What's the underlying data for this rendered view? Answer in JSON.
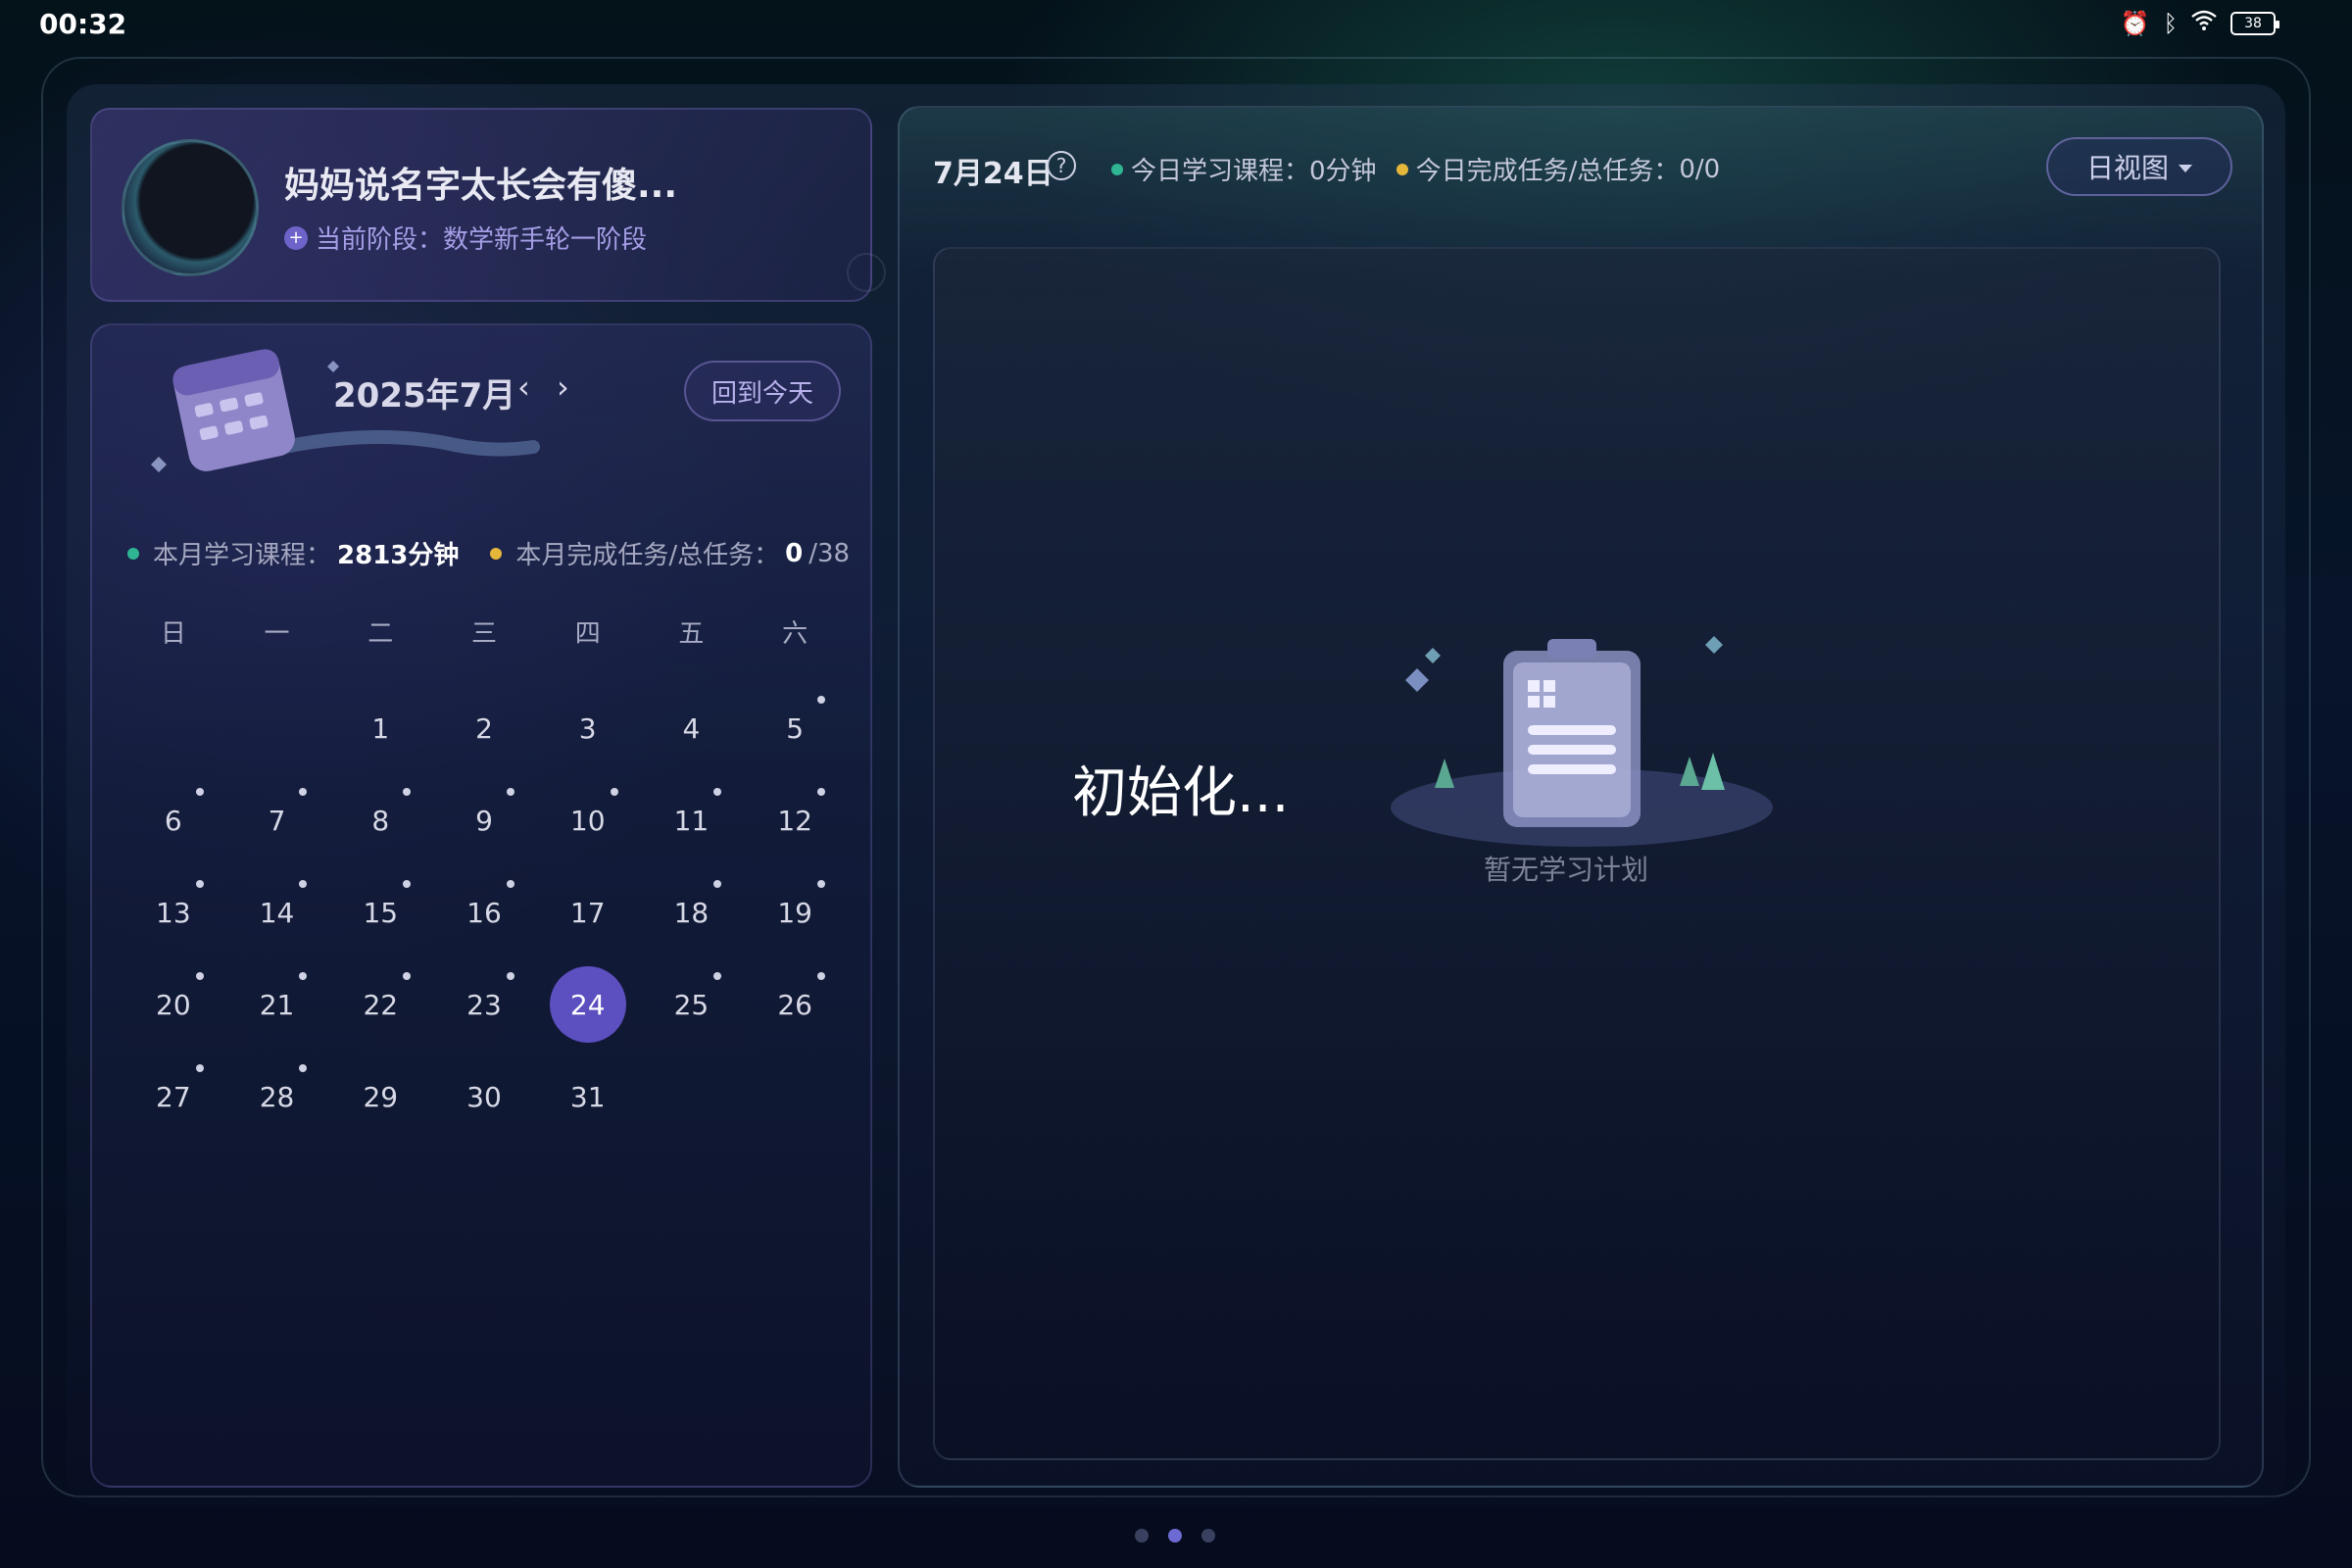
{
  "status_bar": {
    "time": "00:32",
    "battery": "38",
    "icons": [
      "alarm-icon",
      "bluetooth-icon",
      "wifi-icon",
      "battery-icon"
    ]
  },
  "profile": {
    "name": "妈妈说名字太长会有傻...",
    "stage": "当前阶段：数学新手轮一阶段"
  },
  "calendar": {
    "month_title": "2025年7月",
    "prev": "‹",
    "next": "›",
    "today_button": "回到今天",
    "stats": {
      "course_label": "本月学习课程：",
      "course_value": "2813分钟",
      "task_label": "本月完成任务/总任务：",
      "task_done": "0",
      "task_total": "/38"
    },
    "weekdays": [
      "日",
      "一",
      "二",
      "三",
      "四",
      "五",
      "六"
    ],
    "leading_blanks": 2,
    "days": [
      {
        "d": "1",
        "mark": false
      },
      {
        "d": "2",
        "mark": false
      },
      {
        "d": "3",
        "mark": false
      },
      {
        "d": "4",
        "mark": false
      },
      {
        "d": "5",
        "mark": true
      },
      {
        "d": "6",
        "mark": true
      },
      {
        "d": "7",
        "mark": true
      },
      {
        "d": "8",
        "mark": true
      },
      {
        "d": "9",
        "mark": true
      },
      {
        "d": "10",
        "mark": true
      },
      {
        "d": "11",
        "mark": true
      },
      {
        "d": "12",
        "mark": true
      },
      {
        "d": "13",
        "mark": true
      },
      {
        "d": "14",
        "mark": true
      },
      {
        "d": "15",
        "mark": true
      },
      {
        "d": "16",
        "mark": true
      },
      {
        "d": "17",
        "mark": false
      },
      {
        "d": "18",
        "mark": true
      },
      {
        "d": "19",
        "mark": true
      },
      {
        "d": "20",
        "mark": true
      },
      {
        "d": "21",
        "mark": true
      },
      {
        "d": "22",
        "mark": true
      },
      {
        "d": "23",
        "mark": true
      },
      {
        "d": "24",
        "mark": false,
        "selected": true
      },
      {
        "d": "25",
        "mark": true
      },
      {
        "d": "26",
        "mark": true
      },
      {
        "d": "27",
        "mark": true
      },
      {
        "d": "28",
        "mark": true
      },
      {
        "d": "29",
        "mark": false
      },
      {
        "d": "30",
        "mark": false
      },
      {
        "d": "31",
        "mark": false
      }
    ]
  },
  "day_panel": {
    "date": "7月24日",
    "help": "?",
    "course_label": "今日学习课程：",
    "course_value": "0分钟",
    "task_label": "今日完成任务/总任务：",
    "task_value": "0/0",
    "view_button": "日视图",
    "loading_text": "初始化...",
    "empty_text": "暂无学习计划"
  },
  "colors": {
    "accent": "#5c4fbf",
    "green_dot": "#2fb592",
    "yellow_dot": "#e4b73a"
  },
  "pager": {
    "count": 3,
    "active": 1
  }
}
